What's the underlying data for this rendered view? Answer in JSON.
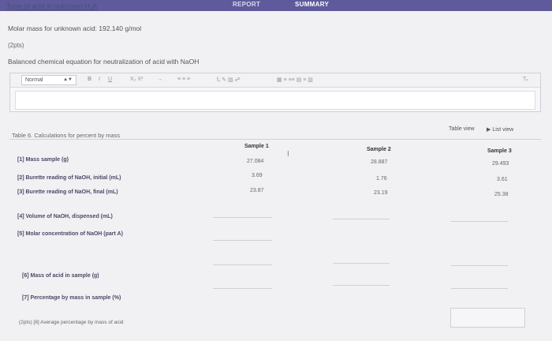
{
  "tabs": {
    "report": "REPORT",
    "summary": "SUMMARY"
  },
  "title": "Type of acid in unknown H₃A",
  "molar_mass": "Molar mass for unknown acid: 192.140 g/mol",
  "points": "(2pts)",
  "balanced_label": "Balanced chemical equation for neutralization of acid with NaOH",
  "editor": {
    "style": "Normal",
    "bold": "B",
    "italic": "I",
    "underline": "U",
    "subsup": "X₂  X²",
    "arrow": "→",
    "lists": "≡ ≡ ≡",
    "misc": "fₓ ✎ ▨ ☍",
    "table_tools": "▦ ≡ ≡≡ ▤ ≡ ▥",
    "clear": "Tₓ"
  },
  "views": {
    "table": "Table view",
    "list": "List view"
  },
  "table_caption": "Table 6. Calculations for percent by mass",
  "samples": [
    {
      "name": "Sample 1",
      "mass": "27.084",
      "initial": "3.69",
      "final": "23.87"
    },
    {
      "name": "Sample 2",
      "mass": "28.887",
      "initial": "1.76",
      "final": "23.19"
    },
    {
      "name": "Sample 3",
      "mass": "29.493",
      "initial": "3.61",
      "final": "25.38"
    }
  ],
  "rows": {
    "mass": "[1] Mass sample (g)",
    "initial": "[2] Burette reading of NaOH, initial (mL)",
    "final": "[3] Burette reading of NaOH, final (mL)",
    "volume": "[4] Volume of NaOH, dispensed (mL)",
    "molar_conc": "[5] Molar concentration of NaOH (part A)",
    "acid_mass": "[6] Mass of acid in sample (g)",
    "percent": "[7] Percentage by mass in sample (%)"
  },
  "average": "(2pts)   [8] Average percentage by mass of acid"
}
